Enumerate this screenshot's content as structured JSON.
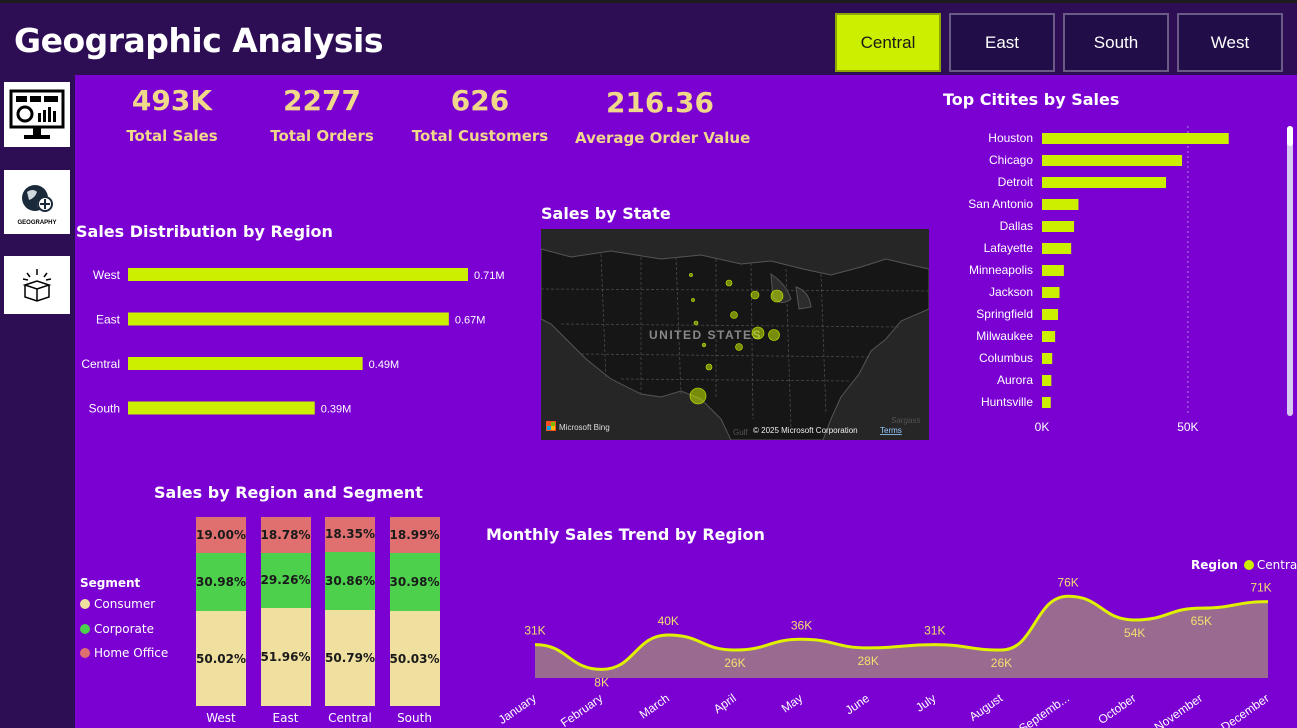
{
  "header": {
    "title": "Geographic Analysis",
    "region_buttons": [
      {
        "label": "Central",
        "active": true
      },
      {
        "label": "East",
        "active": false
      },
      {
        "label": "South",
        "active": false
      },
      {
        "label": "West",
        "active": false
      }
    ]
  },
  "sidebar": {
    "items": [
      {
        "icon": "dashboard-monitor-icon"
      },
      {
        "icon": "geography-globe-icon",
        "label": "GEOGRAPHY"
      },
      {
        "icon": "product-box-icon"
      }
    ]
  },
  "kpis": [
    {
      "value": "493K",
      "label": "Total Sales"
    },
    {
      "value": "2277",
      "label": "Total Orders"
    },
    {
      "value": "626",
      "label": "Total Customers"
    },
    {
      "value": "216.36",
      "label": "Average Order Value"
    }
  ],
  "colors": {
    "accent": "#ccef00",
    "background": "#7b00d2",
    "panel": "#2d0e55",
    "kpi_text": "#f0d88b",
    "consumer": "#f0e0a0",
    "corporate": "#4dd14d",
    "home_office": "#e07070"
  },
  "chart_data": [
    {
      "type": "bar",
      "orientation": "horizontal",
      "title": "Sales Distribution by Region",
      "categories": [
        "West",
        "East",
        "Central",
        "South"
      ],
      "values": [
        0.71,
        0.67,
        0.49,
        0.39
      ],
      "data_labels": [
        "0.71M",
        "0.67M",
        "0.49M",
        "0.39M"
      ],
      "unit": "M"
    },
    {
      "type": "bar",
      "orientation": "horizontal",
      "title": "Top Citites by Sales",
      "categories": [
        "Houston",
        "Chicago",
        "Detroit",
        "San Antonio",
        "Dallas",
        "Lafayette",
        "Minneapolis",
        "Jackson",
        "Springfield",
        "Milwaukee",
        "Columbus",
        "Aurora",
        "Huntsville"
      ],
      "values": [
        64000,
        48000,
        42500,
        12500,
        11000,
        10000,
        7500,
        6000,
        5500,
        4500,
        3500,
        3200,
        3000
      ],
      "xticks": [
        "0K",
        "50K"
      ],
      "xlim": [
        0,
        85000
      ]
    },
    {
      "type": "bar",
      "stacked": true,
      "title": "Sales by Region and Segment",
      "categories": [
        "West",
        "East",
        "Central",
        "South"
      ],
      "legend_title": "Segment",
      "series": [
        {
          "name": "Consumer",
          "values": [
            50.02,
            51.96,
            50.79,
            50.03
          ],
          "labels": [
            "50.02%",
            "51.96%",
            "50.79%",
            "50.03%"
          ]
        },
        {
          "name": "Corporate",
          "values": [
            30.98,
            29.26,
            30.86,
            30.98
          ],
          "labels": [
            "30.98%",
            "29.26%",
            "30.86%",
            "30.98%"
          ]
        },
        {
          "name": "Home Office",
          "values": [
            19.0,
            18.78,
            18.35,
            18.99
          ],
          "labels": [
            "19.00%",
            "18.78%",
            "18.35%",
            "18.99%"
          ]
        }
      ]
    },
    {
      "type": "area",
      "title": "Monthly Sales Trend by Region",
      "legend_title": "Region",
      "categories": [
        "January",
        "February",
        "March",
        "April",
        "May",
        "June",
        "July",
        "August",
        "Septemb...",
        "October",
        "November",
        "December"
      ],
      "series": [
        {
          "name": "Central",
          "values": [
            31,
            8,
            40,
            26,
            36,
            28,
            31,
            26,
            76,
            54,
            65,
            71
          ],
          "labels": [
            "31K",
            "8K",
            "40K",
            "26K",
            "36K",
            "28K",
            "31K",
            "26K",
            "76K",
            "54K",
            "65K",
            "71K"
          ]
        }
      ],
      "unit": "K"
    }
  ],
  "map": {
    "title": "Sales by State",
    "country_label": "UNITED STATES",
    "attribution": "Microsoft Bing",
    "copyright": "© 2025 Microsoft Corporation",
    "terms_link": "Terms",
    "sea_label": "Sargass",
    "gulf_label": "Gulf"
  }
}
